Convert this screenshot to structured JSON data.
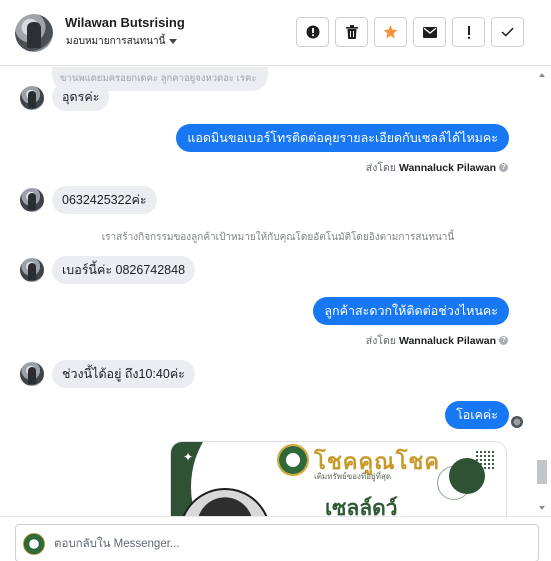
{
  "header": {
    "contact_name": "Wilawan Butsrising",
    "assign_label": "มอบหมายการสนทนานี้",
    "actions": [
      {
        "icon": "alert-circle-icon",
        "tooltip": ""
      },
      {
        "icon": "trash-icon",
        "tooltip": ""
      },
      {
        "icon": "star-icon",
        "tooltip": ""
      },
      {
        "icon": "envelope-icon",
        "tooltip": ""
      },
      {
        "icon": "exclamation-icon",
        "tooltip": ""
      },
      {
        "icon": "checkmark-icon",
        "tooltip": ""
      }
    ],
    "star_color": "#f7923b"
  },
  "conversation": {
    "partial_text": "ขานพแดยมครอยกเดคะ ลูกคาอยูจงหวดอะ เรคะ",
    "messages": [
      {
        "direction": "in",
        "text": "อุดรค่ะ"
      },
      {
        "direction": "out",
        "text": "แอดมินขอเบอร์โทรติดต่อคุยรายละเอียดกับเซลล์ได้ไหมคะ",
        "sent_by_prefix": "ส่งโดย",
        "sent_by_name": "Wannaluck Pilawan"
      },
      {
        "direction": "in",
        "text": "0632425322ค่ะ"
      },
      {
        "direction": "activity",
        "text": "เราสร้างกิจกรรมของลูกค้าเป้าหมายให้กับคุณโดยอัตโนมัติโดยอิงตามการสนทนานี้"
      },
      {
        "direction": "in",
        "text": "เบอร์นี้ค่ะ 0826742848"
      },
      {
        "direction": "out",
        "text": "ลูกค้าสะดวกให้ติดต่อช่วงไหนคะ",
        "sent_by_prefix": "ส่งโดย",
        "sent_by_name": "Wannaluck Pilawan"
      },
      {
        "direction": "in",
        "text": "ช่วงนี้ได้อยู่ ถึง10:40ค่ะ"
      },
      {
        "direction": "out",
        "text": "โอเคค่ะ"
      }
    ],
    "image_card": {
      "brand": "โชคคูณโชค",
      "tagline": "เติมทรัพย์ของที่อยู่ที่สุด",
      "headline": "เซลล์ดว์"
    }
  },
  "composer": {
    "placeholder": "ตอบกลับใน Messenger..."
  },
  "colors": {
    "outgoing_bubble": "#1877f2",
    "incoming_bubble": "#ebedf0"
  }
}
